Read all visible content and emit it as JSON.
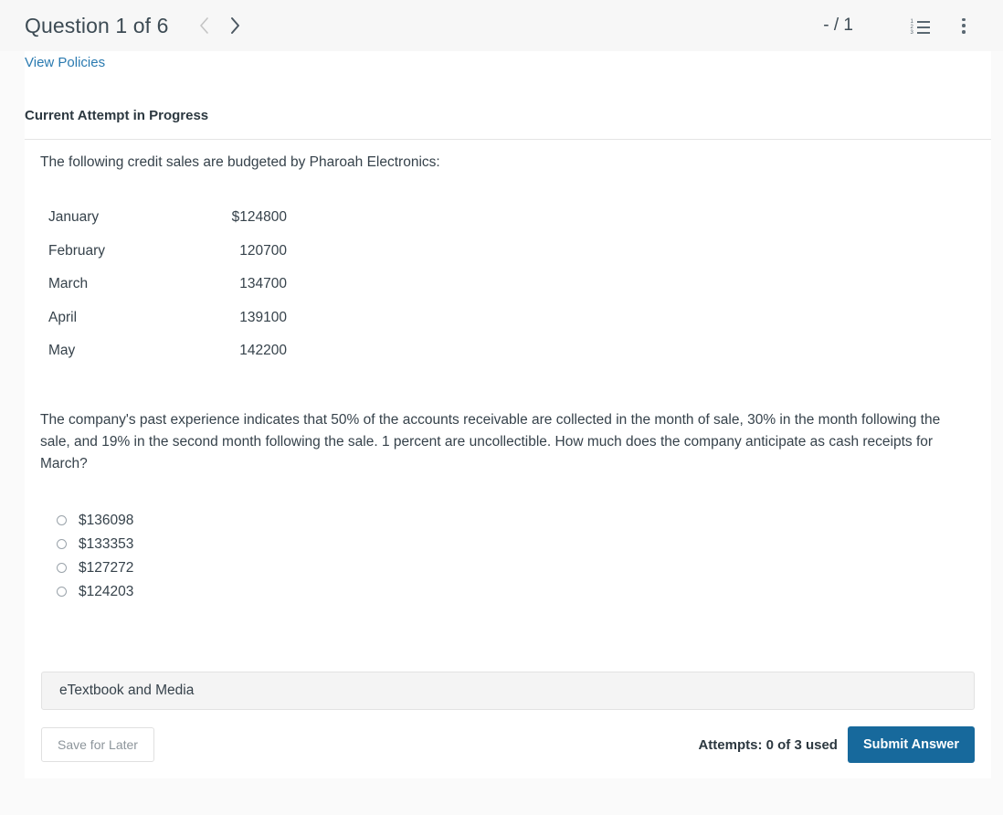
{
  "header": {
    "title": "Question 1 of 6",
    "prev_icon": "chevron-left-icon",
    "next_icon": "chevron-right-icon",
    "score": "- / 1",
    "list_icon": "numbered-list-icon",
    "list_numbers": [
      "1",
      "2",
      "3"
    ],
    "menu_icon": "kebab-menu-icon"
  },
  "card": {
    "view_policies": "View Policies",
    "attempt_heading": "Current Attempt in Progress"
  },
  "question": {
    "intro": "The following credit sales are budgeted by Pharoah Electronics:",
    "table": {
      "rows": [
        {
          "month": "January",
          "amount": "$124800"
        },
        {
          "month": "February",
          "amount": "120700"
        },
        {
          "month": "March",
          "amount": "134700"
        },
        {
          "month": "April",
          "amount": "139100"
        },
        {
          "month": "May",
          "amount": "142200"
        }
      ]
    },
    "prompt": "The company's past experience indicates that 50% of the accounts receivable are collected in the month of sale, 30% in the month following the sale, and 19% in the second month following the sale. 1 percent are uncollectible. How much does the company anticipate as cash receipts for March?",
    "options": [
      {
        "label": "$136098",
        "selected": false
      },
      {
        "label": "$133353",
        "selected": false
      },
      {
        "label": "$127272",
        "selected": false
      },
      {
        "label": "$124203",
        "selected": false
      }
    ]
  },
  "etextbook": {
    "label": "eTextbook and Media"
  },
  "footer": {
    "save_label": "Save for Later",
    "attempts": "Attempts: 0 of 3 used",
    "submit_label": "Submit Answer"
  },
  "colors": {
    "link": "#2a7ab0",
    "submit": "#17699c",
    "header_bg": "#f7f7f7",
    "page_bg": "#fafafa"
  }
}
